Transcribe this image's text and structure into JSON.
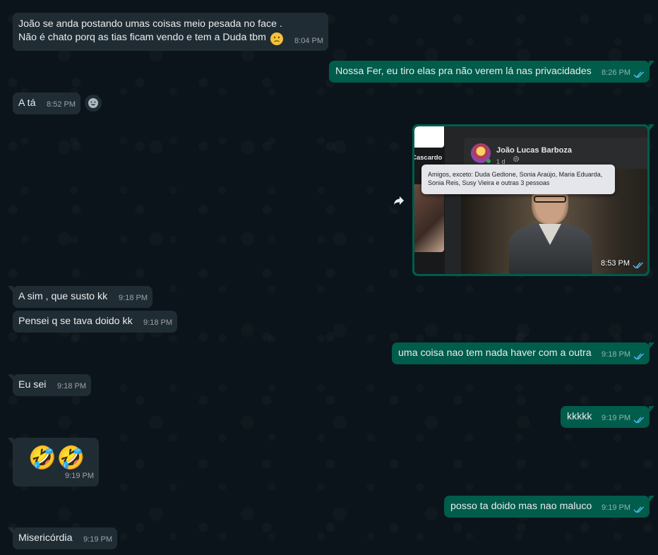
{
  "messages": [
    {
      "id": "m1",
      "dir": "in",
      "lines": [
        "João se anda postando umas coisas meio pesada no face .",
        "Não é chato porq as tias ficam vendo e tem a Duda tbm"
      ],
      "time": "8:04 PM"
    },
    {
      "id": "m2",
      "dir": "out",
      "text": "Nossa Fer, eu tiro elas pra não verem lá nas privacidades",
      "time": "8:26 PM"
    },
    {
      "id": "m3",
      "dir": "in",
      "text": "A tá",
      "time": "8:52 PM"
    },
    {
      "id": "m4",
      "dir": "out",
      "type": "image",
      "time": "8:53 PM",
      "image": {
        "side_label": "Cascardo",
        "name": "João Lucas Barboza",
        "meta": "1 d",
        "privacy_text": "Amigos, exceto: Duda Gedione, Sonia Araújo, Maria Eduarda, Sonia Reis, Susy Vieira e outras 3 pessoas"
      }
    },
    {
      "id": "m5",
      "dir": "in",
      "text": "A sim , que susto kk",
      "time": "9:18 PM"
    },
    {
      "id": "m6",
      "dir": "in",
      "text": "Pensei q se tava doido kk",
      "time": "9:18 PM"
    },
    {
      "id": "m7",
      "dir": "out",
      "text": "uma coisa nao tem nada haver com a outra",
      "time": "9:18 PM"
    },
    {
      "id": "m8",
      "dir": "in",
      "text": "Eu sei",
      "time": "9:18 PM"
    },
    {
      "id": "m9",
      "dir": "out",
      "text": "kkkkk",
      "time": "9:19 PM"
    },
    {
      "id": "m10",
      "dir": "in",
      "type": "emoji",
      "text": "🤣🤣",
      "time": "9:19 PM"
    },
    {
      "id": "m11",
      "dir": "out",
      "text": "posso ta doido mas nao maluco",
      "time": "9:19 PM"
    },
    {
      "id": "m12",
      "dir": "in",
      "text": "Misericórdia",
      "time": "9:19 PM"
    }
  ],
  "icons": {
    "read_ticks": "double-check-icon",
    "react": "smiley-icon",
    "forward": "forward-icon"
  },
  "colors": {
    "background": "#0b141a",
    "incoming": "#202c33",
    "outgoing": "#005c4b",
    "read_ticks": "#53bdeb"
  }
}
